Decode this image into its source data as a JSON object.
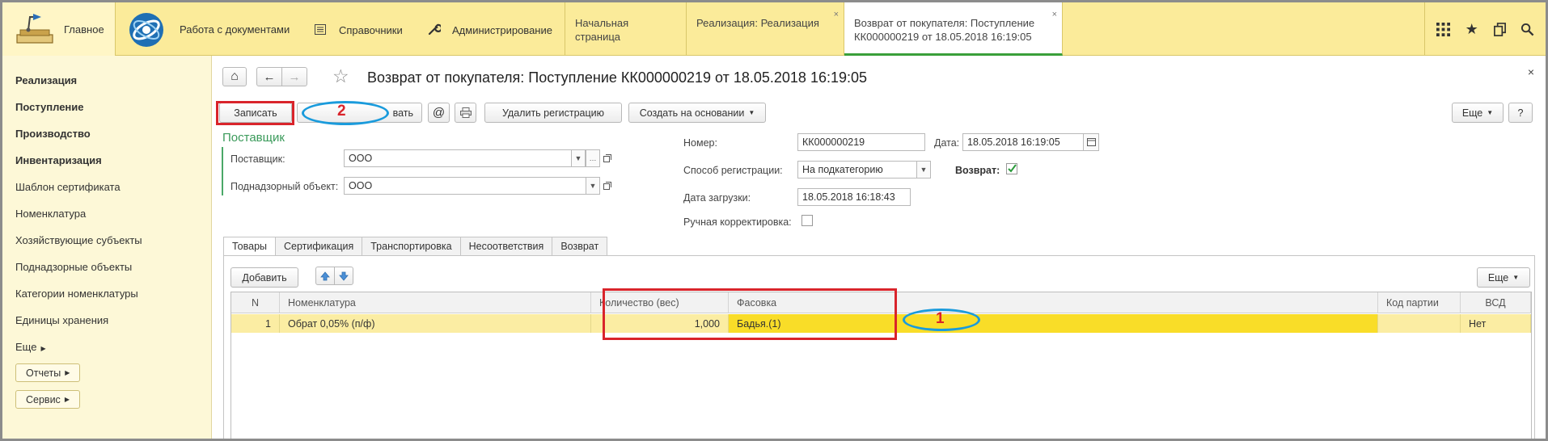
{
  "top": {
    "sections": [
      {
        "label": "Главное",
        "icon": "home-desk-icon"
      },
      {
        "label": "Работа с документами",
        "icon": "globe-logo-icon"
      },
      {
        "label": "Справочники",
        "icon": "list-icon"
      },
      {
        "label": "Администрирование",
        "icon": "wrench-icon"
      }
    ],
    "tabs": [
      {
        "label": "Начальная страница",
        "closable": false
      },
      {
        "label": "Реализация: Реализация",
        "closable": true
      },
      {
        "label": "Возврат от покупателя: Поступление КК000000219 от 18.05.2018 16:19:05",
        "closable": true,
        "active": true
      }
    ],
    "close_glyph": "×",
    "tools": {
      "apps_glyph": "⋮⋮⋮",
      "star_glyph": "★",
      "history_glyph": "⧉",
      "search_glyph": "⚲"
    }
  },
  "sidebar": {
    "items": [
      {
        "label": "Реализация",
        "bold": true
      },
      {
        "label": "Поступление",
        "bold": true
      },
      {
        "label": "Производство",
        "bold": true
      },
      {
        "label": "Инвентаризация",
        "bold": true
      },
      {
        "label": "Шаблон сертификата",
        "bold": false
      },
      {
        "label": "Номенклатура",
        "bold": false
      },
      {
        "label": "Хозяйствующие субъекты",
        "bold": false
      },
      {
        "label": "Поднадзорные объекты",
        "bold": false
      },
      {
        "label": "Категории номенклатуры",
        "bold": false
      },
      {
        "label": "Единицы хранения",
        "bold": false
      }
    ],
    "more_label": "Еще",
    "reports_label": "Отчеты",
    "service_label": "Сервис"
  },
  "form": {
    "title": "Возврат от покупателя: Поступление КК000000219 от 18.05.2018 16:19:05",
    "close_glyph": "×",
    "nav": {
      "home_glyph": "⌂",
      "back_glyph": "←",
      "forward_glyph": "→",
      "star_glyph": "☆"
    },
    "toolbar": {
      "save_label": "Записать",
      "partial_label": "вать",
      "at_glyph": "@",
      "print_glyph": "🖶",
      "delete_reg_label": "Удалить регистрацию",
      "create_based_label": "Создать на основании",
      "more_label": "Еще",
      "help_label": "?"
    },
    "supplier_group": {
      "caption": "Поставщик",
      "supplier_label": "Поставщик:",
      "supplier_value": "ООО",
      "object_label": "Поднадзорный объект:",
      "object_value": "ООО"
    },
    "fields": {
      "number_label": "Номер:",
      "number_value": "КК000000219",
      "date_label": "Дата:",
      "date_value": "18.05.2018 16:19:05",
      "reg_method_label": "Способ регистрации:",
      "reg_method_value": "На подкатегорию",
      "return_label": "Возврат:",
      "return_checked": true,
      "load_date_label": "Дата загрузки:",
      "load_date_value": "18.05.2018 16:18:43",
      "manual_label": "Ручная корректировка:",
      "manual_checked": false
    },
    "tabs": [
      "Товары",
      "Сертификация",
      "Транспортировка",
      "Несоответствия",
      "Возврат"
    ],
    "goods": {
      "add_label": "Добавить",
      "up_glyph": "⇧",
      "down_glyph": "⇩",
      "more_label": "Еще",
      "columns": [
        "N",
        "Номенклатура",
        "Количество (вес)",
        "Фасовка",
        "Код партии",
        "ВСД"
      ],
      "rows": [
        {
          "n": "1",
          "item": "Обрат 0,05% (п/ф)",
          "qty": "1,000",
          "pack": "Бадья.(1)",
          "batch": "",
          "vsd": "Нет"
        }
      ]
    }
  },
  "annotations": {
    "one": "1",
    "two": "2"
  },
  "colors": {
    "top_bg": "#fbeb9a",
    "sidebar_bg": "#fdf8d7",
    "selected_row": "#fbeda3",
    "selected_cell": "#f9dd28",
    "annotation_red": "#d9242b",
    "annotation_blue": "#1a9bdc",
    "group_green": "#3a9a5a"
  }
}
